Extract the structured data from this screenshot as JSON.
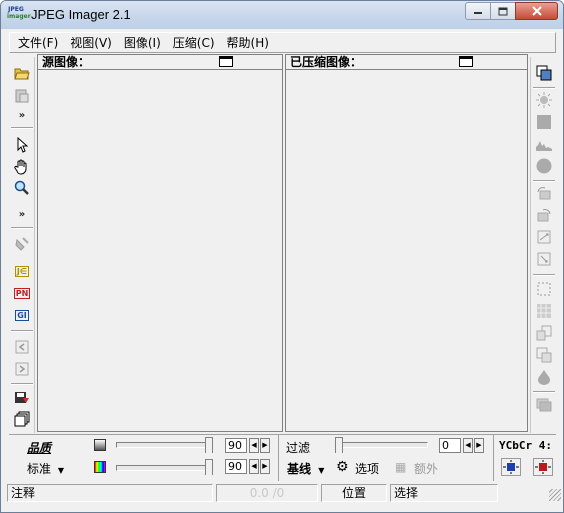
{
  "window": {
    "title": "JPEG Imager 2.1",
    "icon_top": "JPEG",
    "icon_bottom": "imager"
  },
  "menu": {
    "items": [
      {
        "label": "文件(F)"
      },
      {
        "label": "视图(V)"
      },
      {
        "label": "图像(I)"
      },
      {
        "label": "压缩(C)"
      },
      {
        "label": "帮助(H)"
      }
    ]
  },
  "toolbar_left": {
    "icons": [
      "open-folder-icon",
      "paste-icon",
      "more-chevron-icon",
      "pointer-arrow-icon",
      "hand-pan-icon",
      "zoom-magnifier-icon",
      "more-chevron-icon",
      "paint-icon",
      "jpeg-tag-icon",
      "png-tag-icon",
      "gif-tag-icon",
      "arrow-left-icon",
      "arrow-right-icon",
      "save-disk-icon",
      "copy-windows-icon"
    ],
    "more": "»"
  },
  "toolbar_right": {
    "icons": [
      "copy-image-icon",
      "brightness-icon",
      "square-icon",
      "histogram-icon",
      "circle-icon",
      "rotate-left-icon",
      "rotate-right-icon",
      "flip-icon",
      "mirror-icon",
      "select-rect-icon",
      "grid-icon",
      "resize-icon",
      "crop-icon",
      "drop-icon",
      "layers-icon"
    ]
  },
  "panels": {
    "source_title": "源图像：",
    "compressed_title": "已压缩图像："
  },
  "bottom": {
    "quality_label": "品质",
    "standard_label": "标准",
    "quality_value": "90",
    "color_value": "90",
    "filter_label": "过滤",
    "filter_value": "0",
    "baseline_label": "基线",
    "options_label": "选项",
    "extra_label": "额外",
    "ycbcr_label": "YCbCr 4:"
  },
  "status": {
    "comment": "注释",
    "size": "0.0 /0",
    "position": "位置",
    "selection": "选择"
  },
  "colors": {
    "titlebar": "#c7d6ea",
    "window_bg": "#f0f0f0",
    "close_button": "#c74a36"
  }
}
